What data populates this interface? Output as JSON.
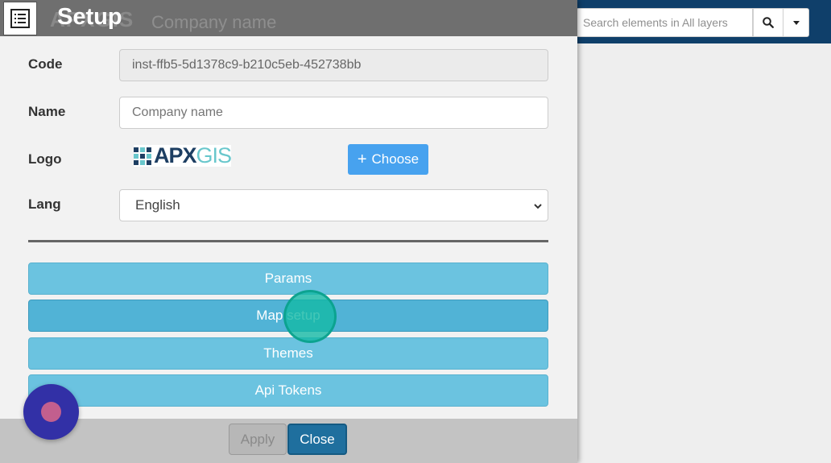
{
  "search": {
    "placeholder": "Search elements in All layers",
    "search_icon": "search-icon",
    "dropdown_icon": "caret-down-icon"
  },
  "modal": {
    "title": "Setup",
    "header_icon": "list-icon",
    "background_brand": "APXGIS",
    "background_company": "Company name",
    "fields": {
      "code_label": "Code",
      "code_value": "inst-ffb5-5d1378c9-b210c5eb-452738bb",
      "name_label": "Name",
      "name_placeholder": "Company name",
      "logo_label": "Logo",
      "logo_text_apx": "APX",
      "logo_text_gis": "GIS",
      "choose_label": "Choose",
      "choose_icon": "plus-icon",
      "lang_label": "Lang",
      "lang_value": "English"
    },
    "menu": [
      {
        "label": "Params"
      },
      {
        "label": "Map setup"
      },
      {
        "label": "Themes"
      },
      {
        "label": "Api Tokens"
      }
    ],
    "active_menu": "Map setup",
    "footer": {
      "apply_label": "Apply",
      "close_label": "Close"
    }
  },
  "colors": {
    "header_bg": "#6f6f6f",
    "topbar_bg": "#0f3f6a",
    "menu_button": "#6bc3e0",
    "choose_button": "#47a2ef",
    "close_button": "#1f6f9e",
    "fab": "#3230a6"
  }
}
